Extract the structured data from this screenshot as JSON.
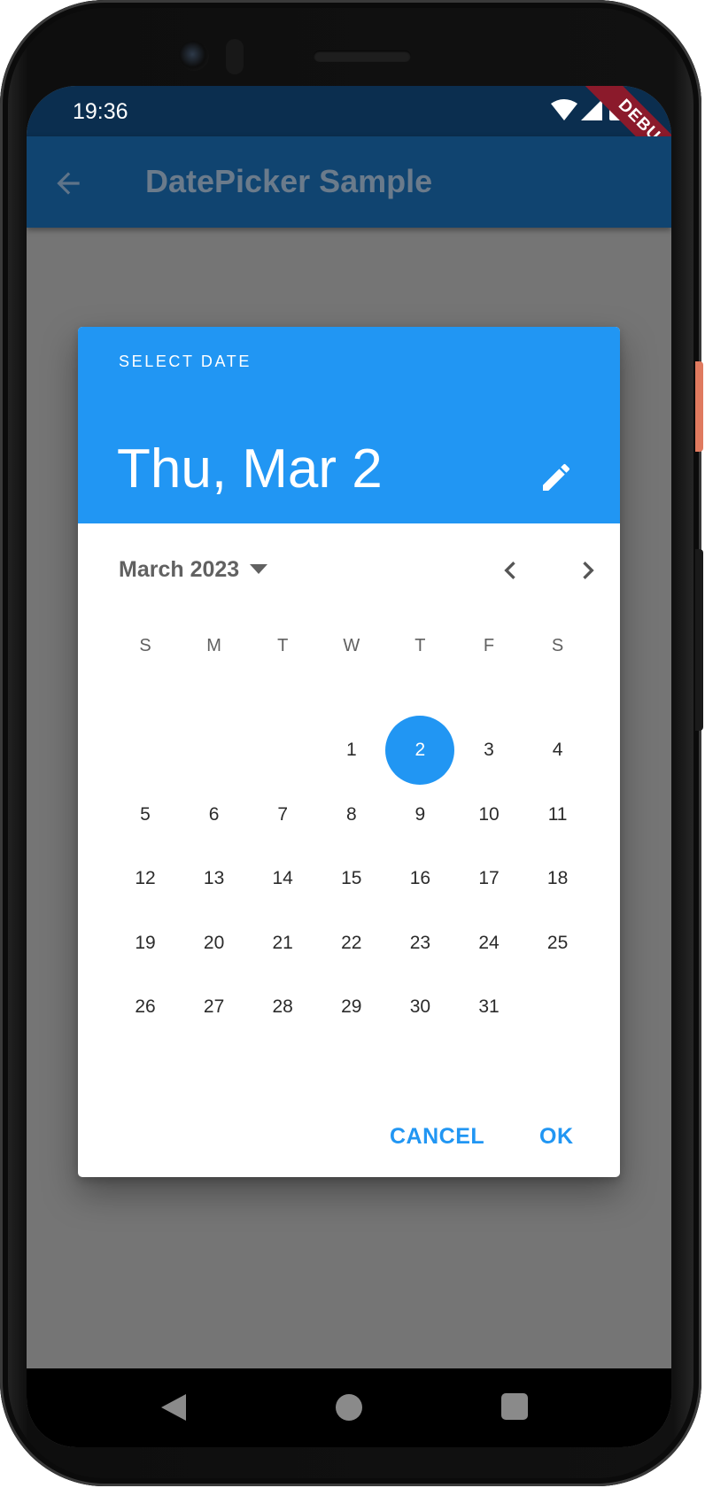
{
  "status_bar": {
    "time": "19:36",
    "debug_banner": "DEBUG",
    "icons": [
      "wifi-icon",
      "signal-icon",
      "battery-icon"
    ]
  },
  "app_bar": {
    "title": "DatePicker Sample",
    "back_icon": "arrow-back-icon"
  },
  "date_picker": {
    "help_text": "SELECT DATE",
    "selected_date_label": "Thu, Mar 2",
    "month_label": "March 2023",
    "weekdays": [
      "S",
      "M",
      "T",
      "W",
      "T",
      "F",
      "S"
    ],
    "first_weekday_index": 3,
    "days": [
      "1",
      "2",
      "3",
      "4",
      "5",
      "6",
      "7",
      "8",
      "9",
      "10",
      "11",
      "12",
      "13",
      "14",
      "15",
      "16",
      "17",
      "18",
      "19",
      "20",
      "21",
      "22",
      "23",
      "24",
      "25",
      "26",
      "27",
      "28",
      "29",
      "30",
      "31"
    ],
    "selected_day": "2",
    "cancel_label": "CANCEL",
    "ok_label": "OK"
  },
  "colors": {
    "primary": "#2196f3",
    "app_bar": "#104470",
    "status_bar": "#0b2e4f",
    "scrim": "#757575",
    "debug_banner": "#8b1a2b"
  },
  "nav_bar": {
    "icons": [
      "back-triangle-icon",
      "home-circle-icon",
      "recents-square-icon"
    ]
  }
}
